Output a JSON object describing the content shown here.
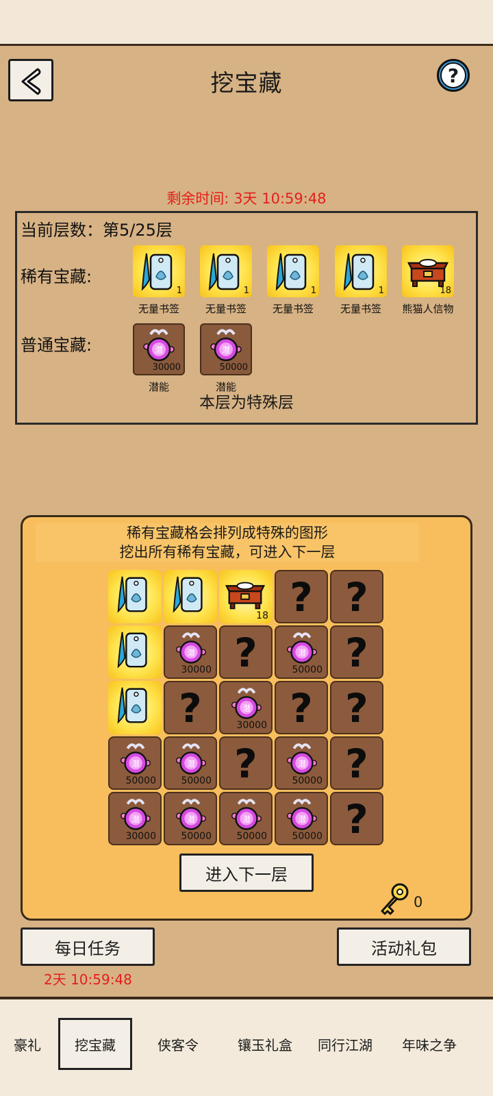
{
  "header": {
    "title": "挖宝藏"
  },
  "countdown": "剩余时间: 3天 10:59:48",
  "layer": {
    "label": "当前层数：第5/25层",
    "rare_label": "稀有宝藏:",
    "common_label": "普通宝藏:",
    "rare_rewards": [
      {
        "name": "无量书签",
        "count": "1",
        "icon": "bookmark-icon"
      },
      {
        "name": "无量书签",
        "count": "1",
        "icon": "bookmark-icon"
      },
      {
        "name": "无量书签",
        "count": "1",
        "icon": "bookmark-icon"
      },
      {
        "name": "无量书签",
        "count": "1",
        "icon": "bookmark-icon"
      },
      {
        "name": "熊猫人信物",
        "count": "18",
        "icon": "treasure-chest-icon"
      }
    ],
    "common_rewards": [
      {
        "name": "潜能",
        "count": "30000",
        "icon": "potential-orb-icon"
      },
      {
        "name": "潜能",
        "count": "50000",
        "icon": "potential-orb-icon"
      }
    ],
    "special_note": "本层为特殊层"
  },
  "board": {
    "hint_line1": "稀有宝藏格会排列成特殊的图形",
    "hint_line2": "挖出所有稀有宝藏，可进入下一层",
    "cells": [
      {
        "type": "rare",
        "icon": "bookmark-icon",
        "count": ""
      },
      {
        "type": "rare",
        "icon": "bookmark-icon",
        "count": ""
      },
      {
        "type": "rare",
        "icon": "treasure-chest-icon",
        "count": "18"
      },
      {
        "type": "hidden",
        "icon": "question-icon",
        "count": ""
      },
      {
        "type": "hidden",
        "icon": "question-icon",
        "count": ""
      },
      {
        "type": "rare",
        "icon": "bookmark-icon",
        "count": ""
      },
      {
        "type": "common",
        "icon": "potential-orb-icon",
        "count": "30000"
      },
      {
        "type": "hidden",
        "icon": "question-icon",
        "count": ""
      },
      {
        "type": "common",
        "icon": "potential-orb-icon",
        "count": "50000"
      },
      {
        "type": "hidden",
        "icon": "question-icon",
        "count": ""
      },
      {
        "type": "rare",
        "icon": "bookmark-icon",
        "count": ""
      },
      {
        "type": "hidden",
        "icon": "question-icon",
        "count": ""
      },
      {
        "type": "common",
        "icon": "potential-orb-icon",
        "count": "30000"
      },
      {
        "type": "hidden",
        "icon": "question-icon",
        "count": ""
      },
      {
        "type": "hidden",
        "icon": "question-icon",
        "count": ""
      },
      {
        "type": "common",
        "icon": "potential-orb-icon",
        "count": "50000"
      },
      {
        "type": "common",
        "icon": "potential-orb-icon",
        "count": "50000"
      },
      {
        "type": "hidden",
        "icon": "question-icon",
        "count": ""
      },
      {
        "type": "common",
        "icon": "potential-orb-icon",
        "count": "50000"
      },
      {
        "type": "hidden",
        "icon": "question-icon",
        "count": ""
      },
      {
        "type": "common",
        "icon": "potential-orb-icon",
        "count": "30000"
      },
      {
        "type": "common",
        "icon": "potential-orb-icon",
        "count": "50000"
      },
      {
        "type": "common",
        "icon": "potential-orb-icon",
        "count": "50000"
      },
      {
        "type": "common",
        "icon": "potential-orb-icon",
        "count": "50000"
      },
      {
        "type": "hidden",
        "icon": "question-icon",
        "count": ""
      }
    ],
    "next_button": "进入下一层",
    "key_count": "0"
  },
  "buttons": {
    "daily_tasks": "每日任务",
    "daily_timer": "2天 10:59:48",
    "gift_pack": "活动礼包"
  },
  "tabs": [
    {
      "label": "豪礼",
      "active": false
    },
    {
      "label": "挖宝藏",
      "active": true
    },
    {
      "label": "侠客令",
      "active": false
    },
    {
      "label": "镶玉礼盒",
      "active": false
    },
    {
      "label": "同行江湖",
      "active": false
    },
    {
      "label": "年味之争",
      "active": false
    }
  ],
  "colors": {
    "background": "#d7b284",
    "panel": "#f8bd5c",
    "rare_tile": "#ffe24a",
    "common_tile": "#8c5b3d",
    "timer_red": "#e3201b"
  }
}
